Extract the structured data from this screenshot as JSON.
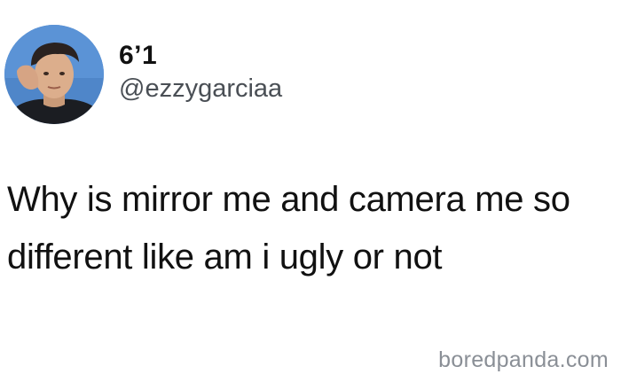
{
  "tweet": {
    "display_name": "6’1",
    "handle": "@ezzygarciaa",
    "text_lines": [
      "Why is mirror me and camera me so",
      "different like am i ugly or not"
    ]
  },
  "watermark": "boredpanda.com",
  "colors": {
    "background": "#ffffff",
    "text": "#111111",
    "handle": "#4a4f55",
    "watermark": "#8a8f96",
    "avatar_bg": "#4f86c9"
  }
}
